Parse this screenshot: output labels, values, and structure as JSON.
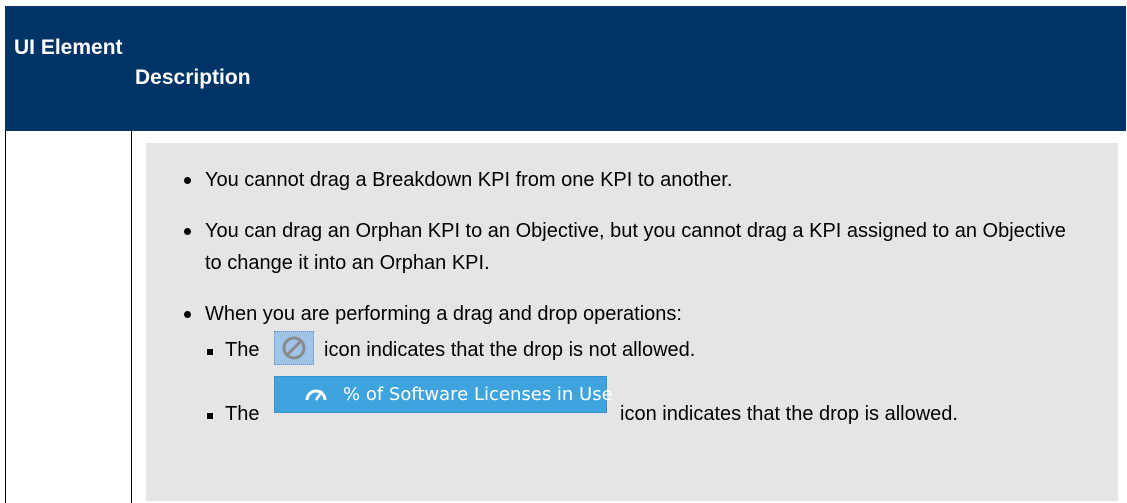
{
  "table": {
    "header": {
      "col1": "UI Element",
      "col2": "Description"
    },
    "row": {
      "bullets": [
        "You cannot drag a Breakdown KPI from one KPI to another.",
        "You can drag an Orphan KPI to an Objective, but you cannot drag a KPI assigned to an Objective to change it into an Orphan KPI.",
        "When you are performing a drag and drop operations:"
      ],
      "sub_bullets": [
        {
          "prefix": "The",
          "suffix": "icon indicates that the drop is not allowed.",
          "icon": "no-drop-icon"
        },
        {
          "prefix": "The",
          "suffix": "icon indicates that the drop is allowed.",
          "icon": "kpi-gauge-icon",
          "icon_label": "% of Software Licenses in Use"
        }
      ]
    }
  },
  "colors": {
    "header_bg": "#003466",
    "header_text": "#ffffff",
    "note_bg": "#e5e5e5",
    "kpi_icon_bg": "#3fa3dd",
    "stop_icon_bg": "#9fc4e8"
  }
}
